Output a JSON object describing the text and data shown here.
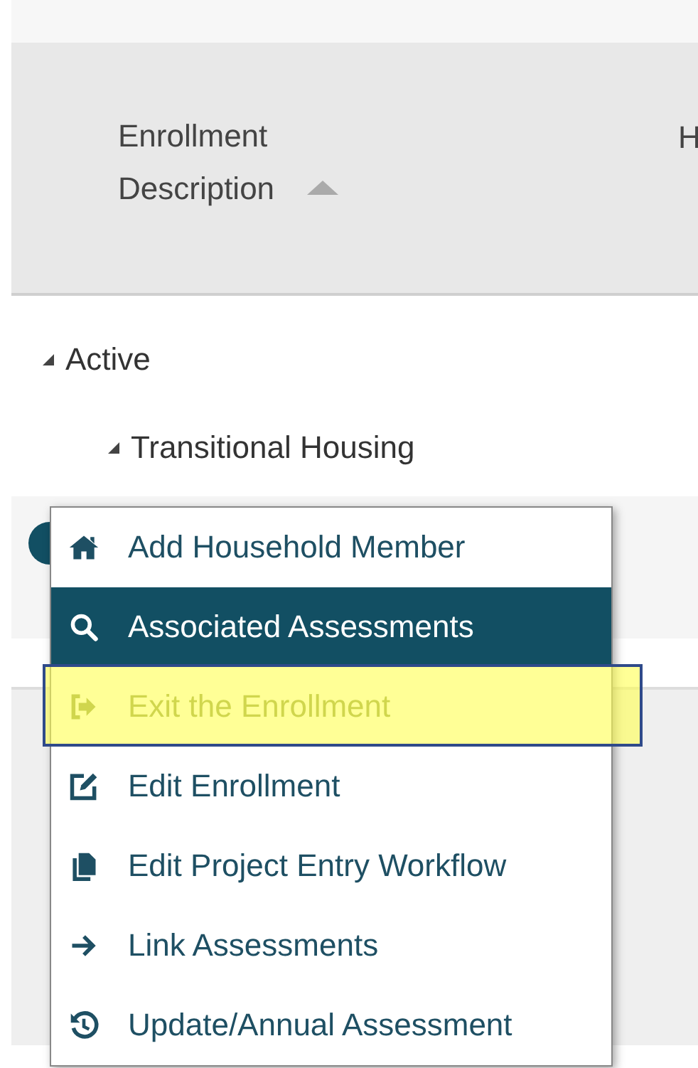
{
  "table": {
    "columns": [
      {
        "label": "Enrollment Description",
        "sorted": true
      },
      {
        "label": "H",
        "sorted": false
      }
    ],
    "tree": [
      {
        "label": "Active",
        "expanded": true,
        "children": [
          {
            "label": "Transitional Housing",
            "expanded": true
          }
        ]
      }
    ]
  },
  "context_menu": {
    "items": [
      {
        "label": "Add Household Member",
        "selected": false,
        "disabled": false,
        "highlighted": false
      },
      {
        "label": "Associated Assessments",
        "selected": true,
        "disabled": false,
        "highlighted": false
      },
      {
        "label": "Exit the Enrollment",
        "selected": false,
        "disabled": true,
        "highlighted": true
      },
      {
        "label": "Edit Enrollment",
        "selected": false,
        "disabled": false,
        "highlighted": false
      },
      {
        "label": "Edit Project Entry Workflow",
        "selected": false,
        "disabled": false,
        "highlighted": false
      },
      {
        "label": "Link Assessments",
        "selected": false,
        "disabled": false,
        "highlighted": false
      },
      {
        "label": "Update/Annual Assessment",
        "selected": false,
        "disabled": false,
        "highlighted": false
      }
    ]
  }
}
